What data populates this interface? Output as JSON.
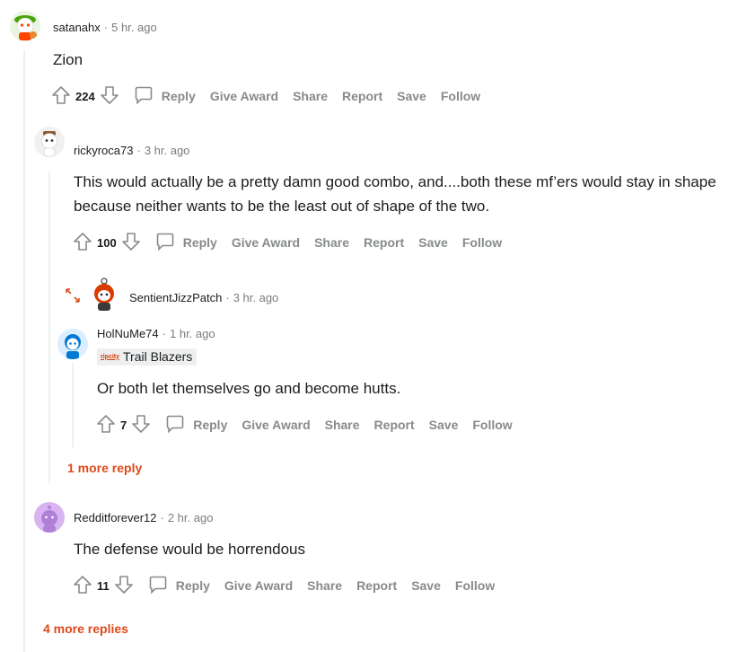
{
  "comments": [
    {
      "id": "c1",
      "username": "satanahx",
      "time": "5 hr. ago",
      "body": "Zion",
      "score": "224"
    },
    {
      "id": "c2",
      "username": "rickyroca73",
      "time": "3 hr. ago",
      "body": "This would actually be a pretty damn good combo, and....both these mf’ers would stay in shape because neither wants to be the least out of shape of the two.",
      "score": "100"
    },
    {
      "id": "c3",
      "username": "SentientJizzPatch",
      "time": "3 hr. ago",
      "collapsed": true
    },
    {
      "id": "c4",
      "username": "HolNuMe74",
      "time": "1 hr. ago",
      "flair_icon_text": "ripcity",
      "flair": "Trail Blazers",
      "body": "Or both let themselves go and become hutts.",
      "score": "7"
    },
    {
      "id": "c5",
      "username": "Redditforever12",
      "time": "2 hr. ago",
      "body": "The defense would be horrendous",
      "score": "11"
    }
  ],
  "actions": {
    "reply": "Reply",
    "give_award": "Give Award",
    "share": "Share",
    "report": "Report",
    "save": "Save",
    "follow": "Follow"
  },
  "more_links": {
    "one_more": "1 more reply",
    "four_more": "4 more replies"
  },
  "colors": {
    "more_link": "#e0491c",
    "action_text": "#878a8c",
    "thread_line": "#edeff1"
  },
  "icons": [
    "upvote-icon",
    "downvote-icon",
    "reply-bubble-icon",
    "expand-arrows-icon",
    "snoo-avatar"
  ]
}
